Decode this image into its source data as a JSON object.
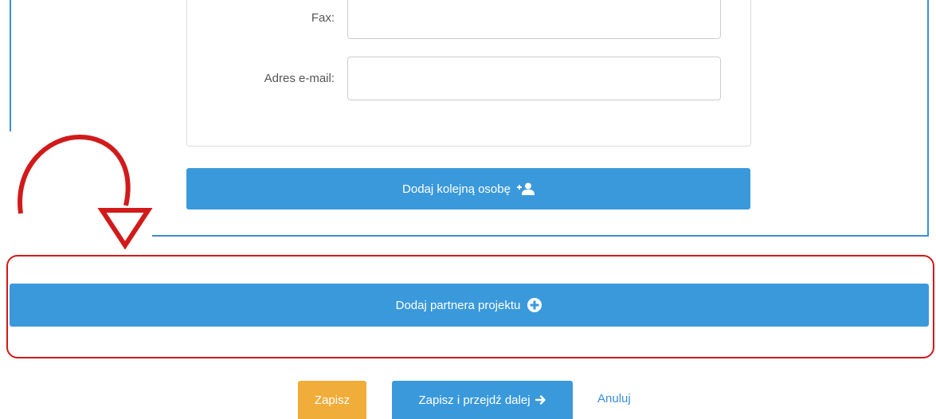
{
  "form": {
    "fax_label": "Fax:",
    "fax_value": "",
    "email_label": "Adres e-mail:",
    "email_value": ""
  },
  "buttons": {
    "add_person": "Dodaj kolejną osobę",
    "add_partner": "Dodaj partnera projektu",
    "save": "Zapisz",
    "save_next": "Zapisz i przejdź dalej",
    "cancel": "Anuluj"
  },
  "icons": {
    "add_person": "user-plus-icon",
    "add_partner": "plus-circle-icon",
    "save_next": "arrow-right-icon",
    "annotation": "curved-arrow-annotation"
  },
  "colors": {
    "primary": "#3a99db",
    "warning": "#f0ad3a",
    "link": "#3a8fd6",
    "annotation": "#d11a1a"
  }
}
